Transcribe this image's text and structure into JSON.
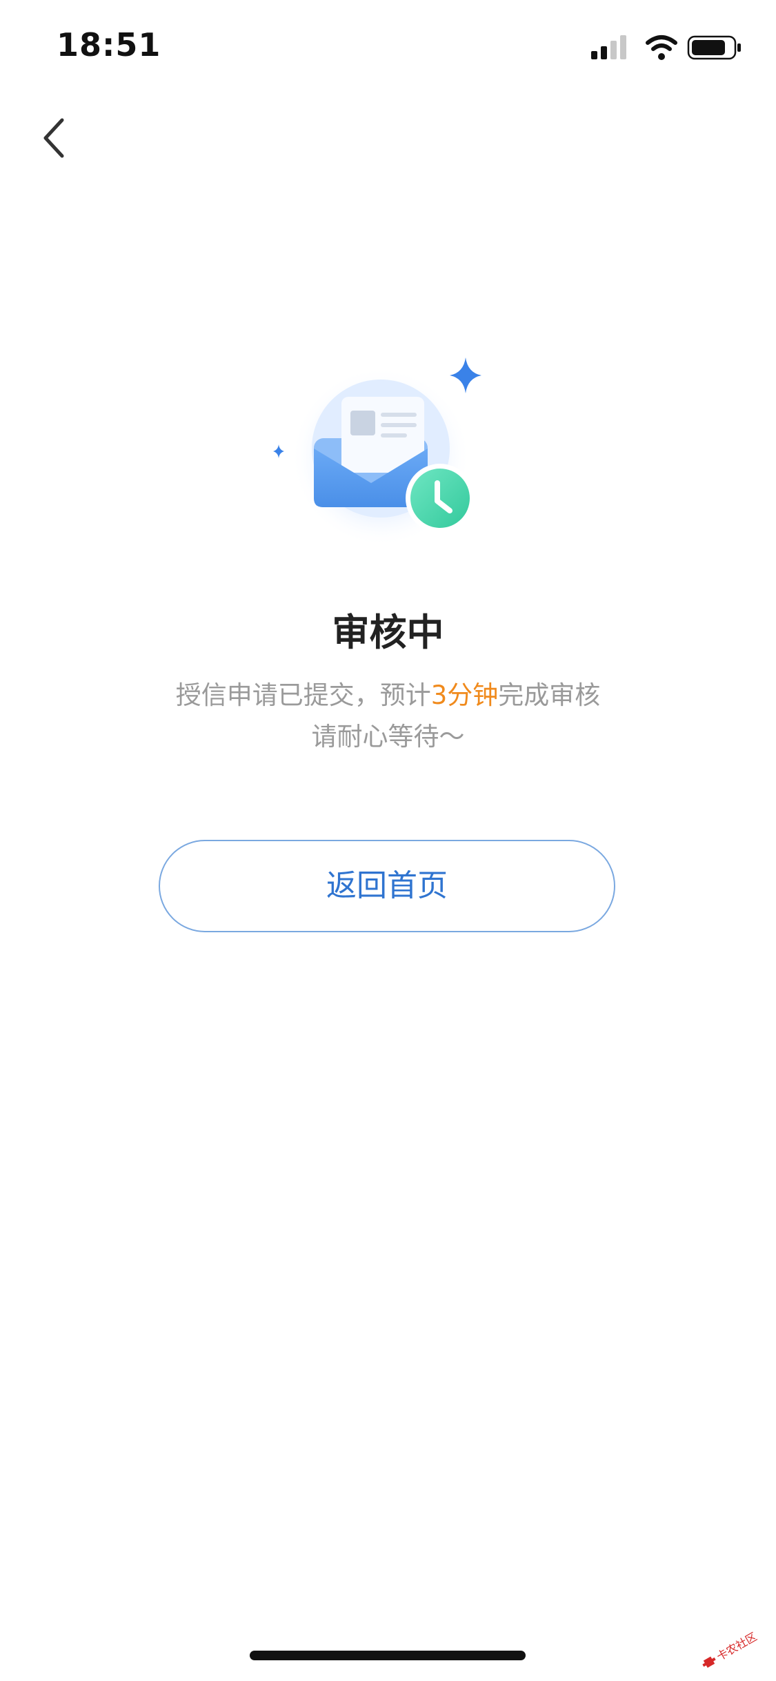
{
  "status_bar": {
    "time": "18:51",
    "icons": [
      "cellular-signal-icon",
      "wifi-icon",
      "battery-icon"
    ]
  },
  "nav": {
    "back_icon": "chevron-left-icon"
  },
  "illustration": {
    "icons": [
      "envelope-icon",
      "clock-icon",
      "sparkle-icon"
    ],
    "colors": {
      "envelope_blue": "#5b9ff0",
      "clock_green": "#4fd9b0",
      "sparkle_blue": "#3a82e8"
    }
  },
  "review": {
    "title": "审核中",
    "line1_prefix": "授信申请已提交，预计",
    "line1_highlight": "3分钟",
    "line1_suffix": "完成审核",
    "line2": "请耐心等待～",
    "highlight_color": "#f08a1c"
  },
  "actions": {
    "home_label": "返回首页"
  },
  "watermark": {
    "text": "卡农社区"
  }
}
